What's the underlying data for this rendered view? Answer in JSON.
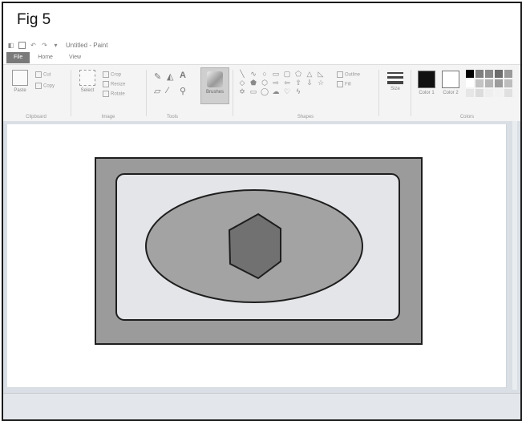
{
  "figure": {
    "label": "Fig 5"
  },
  "window": {
    "title": "Untitled - Paint"
  },
  "quick_access": [
    {
      "icon": "paint-app-icon"
    },
    {
      "icon": "save-icon"
    },
    {
      "icon": "undo-icon"
    },
    {
      "icon": "redo-icon"
    },
    {
      "icon": "customize-toolbar-icon"
    }
  ],
  "tabs": [
    {
      "label": "File",
      "active": true
    },
    {
      "label": "Home",
      "active": false
    },
    {
      "label": "View",
      "active": false
    }
  ],
  "ribbon": {
    "clipboard": {
      "paste": "Paste",
      "cut": "Cut",
      "copy": "Copy",
      "group": "Clipboard"
    },
    "image": {
      "select": "Select",
      "crop": "Crop",
      "resize": "Resize",
      "rotate": "Rotate",
      "group": "Image"
    },
    "tools": {
      "group": "Tools",
      "text_tool": "A"
    },
    "brushes": {
      "label": "Brushes"
    },
    "shapes": {
      "outline": "Outline",
      "fill": "Fill",
      "group": "Shapes"
    },
    "size": {
      "label": "Size"
    },
    "colors": {
      "color1": "Color 1",
      "color2": "Color 2",
      "group": "Colors",
      "color1_value": "#111111",
      "color2_value": "#ffffff"
    }
  },
  "palette": [
    "#000000",
    "#7f7f7f",
    "#8a8a8a",
    "#6d6d6d",
    "#9a9a9a",
    "#ffffff",
    "#c3c3c3",
    "#b5b5b5",
    "#9c9c9c",
    "#bdbdbd",
    "#e6e6e6",
    "#dcdcdc",
    "#eeeeee",
    "#f2f2f2",
    "#e0e0e0"
  ],
  "drawing_colors": {
    "outer_rect_fill": "#9b9b9b",
    "inner_rect_fill": "#e3e5e8",
    "ellipse_fill": "#a3a3a3",
    "hexagon_fill": "#717171",
    "stroke": "#1e1e1e"
  }
}
